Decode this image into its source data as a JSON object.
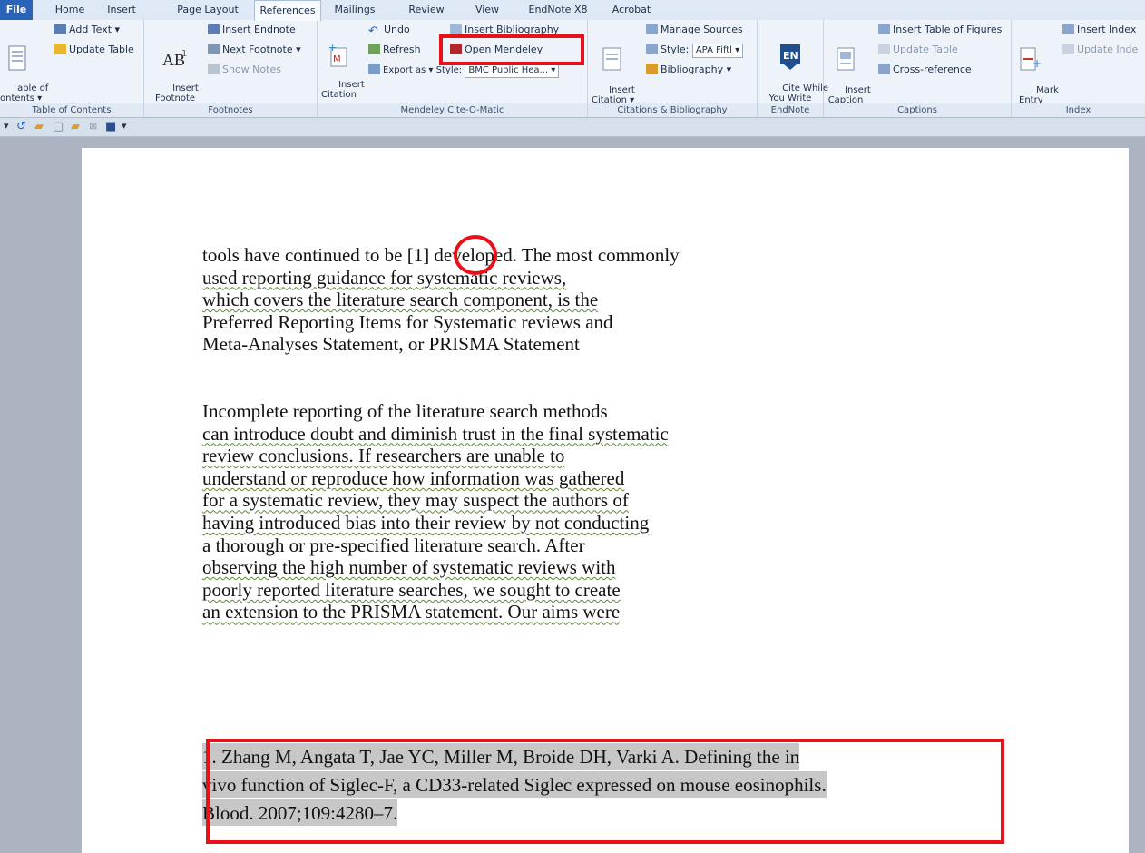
{
  "tabs": [
    "File",
    "Home",
    "Insert",
    "Page Layout",
    "References",
    "Mailings",
    "Review",
    "View",
    "EndNote X8",
    "Acrobat"
  ],
  "ribbon": {
    "toc": {
      "big_label": "able of\nontents ▾",
      "add_text": "Add Text ▾",
      "update_table": "Update Table",
      "group": "Table of Contents"
    },
    "footnotes": {
      "insert_footnote": "Insert\nFootnote",
      "insert_endnote": "Insert Endnote",
      "next_footnote": "Next Footnote ▾",
      "show_notes": "Show Notes",
      "group": "Footnotes"
    },
    "mendeley": {
      "insert_citation": "Insert\nCitation",
      "undo": "Undo",
      "refresh": "Refresh",
      "export_as": "Export as ▾",
      "style_label": "Style:",
      "style_value": "BMC Public Hea... ▾",
      "insert_bibliography": "Insert Bibliography",
      "open_mendeley": "Open Mendeley",
      "group": "Mendeley Cite-O-Matic"
    },
    "citations": {
      "insert_citation": "Insert\nCitation ▾",
      "manage_sources": "Manage Sources",
      "style_label": "Style:",
      "style_value": "APA Fiftl ▾",
      "bibliography": "Bibliography ▾",
      "group": "Citations & Bibliography"
    },
    "endnote": {
      "cite_while": "Cite While\nYou Write",
      "group": "EndNote"
    },
    "captions": {
      "insert_caption": "Insert\nCaption",
      "insert_tof": "Insert Table of Figures",
      "update_table": "Update Table",
      "cross_ref": "Cross-reference",
      "group": "Captions"
    },
    "index": {
      "mark_entry": "Mark\nEntry",
      "insert_index": "Insert Index",
      "update_index": "Update Inde",
      "group": "Index"
    }
  },
  "document": {
    "para1": [
      "tools have continued to be [1] developed. The most commonly",
      "used reporting guidance for systematic reviews,",
      "which covers the literature search component, is the",
      "Preferred Reporting Items for Systematic reviews and",
      "Meta-Analyses Statement, or PRISMA Statement"
    ],
    "para2": [
      "Incomplete reporting of the literature search methods",
      "can introduce doubt and diminish trust in the final systematic",
      "review conclusions. If researchers are unable to",
      "understand or reproduce how information was gathered",
      "for a systematic review, they may suspect the authors of",
      "having introduced bias into their review by not conducting",
      "a thorough or pre-specified literature search. After",
      "observing the high number of systematic reviews with",
      "poorly reported literature searches, we sought to create",
      "an extension to the PRISMA statement. Our aims were"
    ],
    "reference": [
      "1. Zhang M, Angata T, Jae YC, Miller M, Broide DH, Varki A. Defining the in",
      "vivo function of Siglec-F, a CD33-related Siglec expressed on mouse eosinophils.",
      "Blood. 2007;109:4280–7."
    ]
  },
  "colors": {
    "highlight_box": "#e8111a",
    "file_tab": "#2a63b8",
    "ribbon_bg": "#eef3fa"
  }
}
